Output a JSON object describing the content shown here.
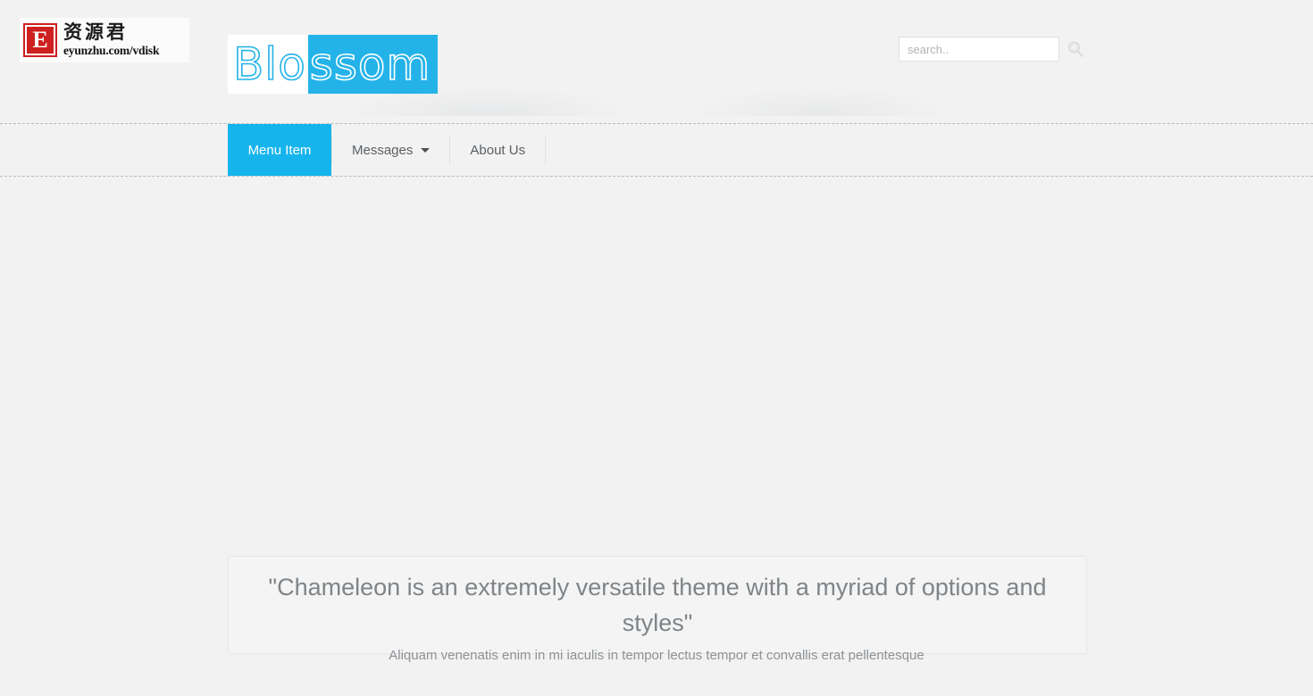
{
  "colors": {
    "page_bg": "#f2f2f2",
    "accent": "#16b4ed",
    "brand_cyan": "#24b3e8",
    "badge_red": "#cf2020",
    "muted_text": "#7f8488"
  },
  "watermark": {
    "badge_letter": "E",
    "chinese": "资源君",
    "url": "eyunzhu.com/vdisk"
  },
  "brand": {
    "part_one": "Blo",
    "part_two": "ssom",
    "full": "Blossom"
  },
  "search": {
    "placeholder": "search..",
    "value": "",
    "icon": "search-icon"
  },
  "nav": {
    "items": [
      {
        "label": "Menu Item",
        "active": true,
        "has_caret": false
      },
      {
        "label": "Messages",
        "active": false,
        "has_caret": true
      },
      {
        "label": "About Us",
        "active": false,
        "has_caret": false
      }
    ]
  },
  "hero": {
    "quote": "\"Chameleon is an extremely versatile theme with a myriad of options and styles\"",
    "subtitle": "Aliquam venenatis enim in mi iaculis in tempor lectus tempor et convallis erat pellentesque"
  }
}
